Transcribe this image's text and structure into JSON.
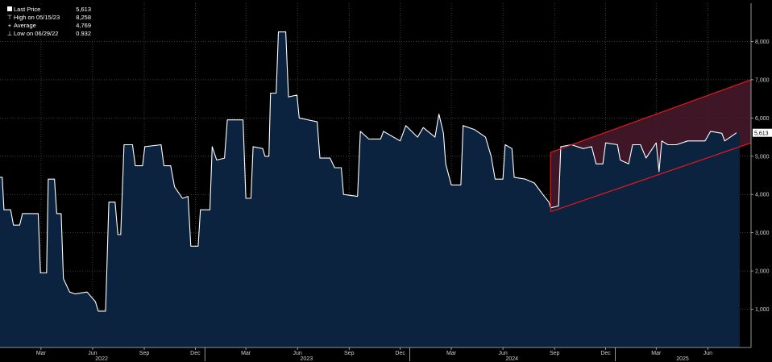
{
  "legend": [
    {
      "symbol": "square",
      "label": "Last Price",
      "value": "5,613"
    },
    {
      "symbol": "high-marker",
      "label": "High on 05/15/23",
      "value": "8,258"
    },
    {
      "symbol": "average-marker",
      "label": "Average",
      "value": "4,769"
    },
    {
      "symbol": "low-marker",
      "label": "Low on 06/29/22",
      "value": "0.932"
    }
  ],
  "colors": {
    "background": "#000000",
    "area_fill": "#0c2340",
    "line": "#ffffff",
    "channel_line": "#e8161b",
    "channel_fill": "#4a1a2c",
    "grid": "#555555",
    "axis_text": "#cfcfcf"
  },
  "chart_data": {
    "type": "area",
    "title": "",
    "xlabel": "",
    "ylabel": "",
    "ylim": [
      0,
      9000
    ],
    "grid": true,
    "legend_position": "top-left",
    "y_ticks": [
      "1,000",
      "2,000",
      "3,000",
      "4,000",
      "5,000",
      "6,000",
      "7,000",
      "8,000"
    ],
    "y_tick_values": [
      1000,
      2000,
      3000,
      4000,
      5000,
      6000,
      7000,
      8000
    ],
    "month_labels": [
      "Mar",
      "Jun",
      "Sep",
      "Dec",
      "Mar",
      "Jun",
      "Sep",
      "Dec",
      "Mar",
      "Jun",
      "Sep",
      "Dec",
      "Mar",
      "Jun"
    ],
    "month_label_dates": [
      "2022-03",
      "2022-06",
      "2022-09",
      "2022-12",
      "2023-03",
      "2023-06",
      "2023-09",
      "2023-12",
      "2024-03",
      "2024-06",
      "2024-09",
      "2024-12",
      "2025-03",
      "2025-06"
    ],
    "year_labels": [
      "2022",
      "2023",
      "2024",
      "2025"
    ],
    "year_label_dates": [
      "2022-07",
      "2023-07",
      "2024-07",
      "2025-05"
    ],
    "last_price_label": "5,613",
    "last_price": 5613,
    "x_range": [
      "2022-01-01",
      "2025-08-31"
    ],
    "series": [
      {
        "name": "Last Price",
        "points": [
          [
            "2022-01-01",
            4450
          ],
          [
            "2022-01-05",
            4450
          ],
          [
            "2022-01-08",
            3600
          ],
          [
            "2022-01-20",
            3600
          ],
          [
            "2022-01-25",
            3200
          ],
          [
            "2022-02-05",
            3200
          ],
          [
            "2022-02-10",
            3500
          ],
          [
            "2022-03-10",
            3500
          ],
          [
            "2022-03-14",
            1950
          ],
          [
            "2022-03-25",
            1950
          ],
          [
            "2022-03-28",
            4400
          ],
          [
            "2022-04-08",
            4400
          ],
          [
            "2022-04-12",
            3500
          ],
          [
            "2022-04-20",
            3500
          ],
          [
            "2022-04-24",
            1800
          ],
          [
            "2022-05-05",
            1450
          ],
          [
            "2022-05-15",
            1400
          ],
          [
            "2022-06-05",
            1450
          ],
          [
            "2022-06-20",
            1200
          ],
          [
            "2022-06-25",
            950
          ],
          [
            "2022-07-08",
            950
          ],
          [
            "2022-07-14",
            3800
          ],
          [
            "2022-07-25",
            3800
          ],
          [
            "2022-07-30",
            2950
          ],
          [
            "2022-08-04",
            2950
          ],
          [
            "2022-08-10",
            5300
          ],
          [
            "2022-08-25",
            5300
          ],
          [
            "2022-08-30",
            4750
          ],
          [
            "2022-09-12",
            4750
          ],
          [
            "2022-09-16",
            5250
          ],
          [
            "2022-10-15",
            5300
          ],
          [
            "2022-10-20",
            4750
          ],
          [
            "2022-11-01",
            4750
          ],
          [
            "2022-11-08",
            4200
          ],
          [
            "2022-11-22",
            3900
          ],
          [
            "2022-12-02",
            3950
          ],
          [
            "2022-12-07",
            2650
          ],
          [
            "2022-12-20",
            2650
          ],
          [
            "2022-12-24",
            3600
          ],
          [
            "2023-01-10",
            3600
          ],
          [
            "2023-01-14",
            5250
          ],
          [
            "2023-01-22",
            4900
          ],
          [
            "2023-02-05",
            4950
          ],
          [
            "2023-02-10",
            5950
          ],
          [
            "2023-03-10",
            5950
          ],
          [
            "2023-03-15",
            3900
          ],
          [
            "2023-03-24",
            3900
          ],
          [
            "2023-03-28",
            5250
          ],
          [
            "2023-04-14",
            5200
          ],
          [
            "2023-04-18",
            5000
          ],
          [
            "2023-04-25",
            5000
          ],
          [
            "2023-04-28",
            6650
          ],
          [
            "2023-05-08",
            6650
          ],
          [
            "2023-05-12",
            8250
          ],
          [
            "2023-05-25",
            8250
          ],
          [
            "2023-05-30",
            6550
          ],
          [
            "2023-06-14",
            6600
          ],
          [
            "2023-06-18",
            6000
          ],
          [
            "2023-07-20",
            5900
          ],
          [
            "2023-07-25",
            4950
          ],
          [
            "2023-08-12",
            4950
          ],
          [
            "2023-08-20",
            4700
          ],
          [
            "2023-09-01",
            4700
          ],
          [
            "2023-09-05",
            4000
          ],
          [
            "2023-09-30",
            3950
          ],
          [
            "2023-10-05",
            5650
          ],
          [
            "2023-10-20",
            5450
          ],
          [
            "2023-11-10",
            5450
          ],
          [
            "2023-11-15",
            5650
          ],
          [
            "2023-12-15",
            5400
          ],
          [
            "2023-12-25",
            5800
          ],
          [
            "2024-01-15",
            5500
          ],
          [
            "2024-01-25",
            5750
          ],
          [
            "2024-02-15",
            5500
          ],
          [
            "2024-02-22",
            6100
          ],
          [
            "2024-03-01",
            5600
          ],
          [
            "2024-03-05",
            4800
          ],
          [
            "2024-03-15",
            4250
          ],
          [
            "2024-04-01",
            4250
          ],
          [
            "2024-04-05",
            5800
          ],
          [
            "2024-04-25",
            5700
          ],
          [
            "2024-05-15",
            5500
          ],
          [
            "2024-05-25",
            5000
          ],
          [
            "2024-06-01",
            4400
          ],
          [
            "2024-06-15",
            4400
          ],
          [
            "2024-06-19",
            5300
          ],
          [
            "2024-07-01",
            5200
          ],
          [
            "2024-07-05",
            4450
          ],
          [
            "2024-07-25",
            4400
          ],
          [
            "2024-08-10",
            4300
          ],
          [
            "2024-08-25",
            4000
          ],
          [
            "2024-09-05",
            3800
          ],
          [
            "2024-09-08",
            3650
          ],
          [
            "2024-09-22",
            3700
          ],
          [
            "2024-09-26",
            5250
          ],
          [
            "2024-10-15",
            5300
          ],
          [
            "2024-11-05",
            5200
          ],
          [
            "2024-11-20",
            5250
          ],
          [
            "2024-11-28",
            4800
          ],
          [
            "2024-12-10",
            4800
          ],
          [
            "2024-12-15",
            5350
          ],
          [
            "2025-01-05",
            5300
          ],
          [
            "2025-01-10",
            4900
          ],
          [
            "2025-01-25",
            4800
          ],
          [
            "2025-02-01",
            5300
          ],
          [
            "2025-02-15",
            5300
          ],
          [
            "2025-02-25",
            4950
          ],
          [
            "2025-03-15",
            5350
          ],
          [
            "2025-03-20",
            4600
          ],
          [
            "2025-03-25",
            5400
          ],
          [
            "2025-04-05",
            5300
          ],
          [
            "2025-04-20",
            5300
          ],
          [
            "2025-05-10",
            5400
          ],
          [
            "2025-06-10",
            5400
          ],
          [
            "2025-06-20",
            5650
          ],
          [
            "2025-07-10",
            5600
          ],
          [
            "2025-07-15",
            5400
          ],
          [
            "2025-07-25",
            5500
          ],
          [
            "2025-08-05",
            5613
          ]
        ]
      }
    ],
    "trend_channel": {
      "start": "2024-09-08",
      "end": "2025-09-05",
      "upper": [
        5100,
        7000
      ],
      "lower": [
        3550,
        5350
      ]
    }
  }
}
